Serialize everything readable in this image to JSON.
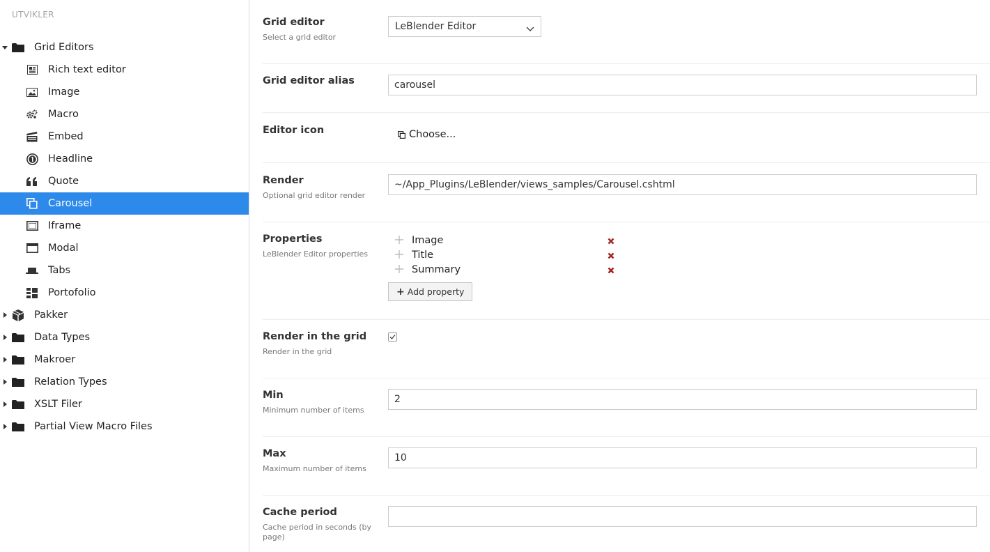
{
  "sidebar": {
    "section_title": "UTVIKLER",
    "tree": [
      {
        "label": "Grid Editors",
        "icon": "folder-icon",
        "expanded": true,
        "children": [
          {
            "label": "Rich text editor",
            "icon": "rich-text-icon"
          },
          {
            "label": "Image",
            "icon": "image-icon"
          },
          {
            "label": "Macro",
            "icon": "gears-icon"
          },
          {
            "label": "Embed",
            "icon": "film-icon"
          },
          {
            "label": "Headline",
            "icon": "headline-icon"
          },
          {
            "label": "Quote",
            "icon": "quote-icon"
          },
          {
            "label": "Carousel",
            "icon": "carousel-icon",
            "selected": true
          },
          {
            "label": "Iframe",
            "icon": "iframe-icon"
          },
          {
            "label": "Modal",
            "icon": "modal-icon"
          },
          {
            "label": "Tabs",
            "icon": "tabs-icon"
          },
          {
            "label": "Portofolio",
            "icon": "portfolio-icon"
          }
        ]
      },
      {
        "label": "Pakker",
        "icon": "package-icon"
      },
      {
        "label": "Data Types",
        "icon": "folder-icon"
      },
      {
        "label": "Makroer",
        "icon": "folder-icon"
      },
      {
        "label": "Relation Types",
        "icon": "folder-icon"
      },
      {
        "label": "XSLT Filer",
        "icon": "folder-icon"
      },
      {
        "label": "Partial View Macro Files",
        "icon": "folder-icon"
      }
    ]
  },
  "form": {
    "grid_editor": {
      "label": "Grid editor",
      "description": "Select a grid editor",
      "selected": "LeBlender Editor"
    },
    "alias": {
      "label": "Grid editor alias",
      "value": "carousel"
    },
    "icon": {
      "label": "Editor icon",
      "choose_label": "Choose..."
    },
    "render": {
      "label": "Render",
      "description": "Optional grid editor render",
      "value": "~/App_Plugins/LeBlender/views_samples/Carousel.cshtml"
    },
    "properties": {
      "label": "Properties",
      "description": "LeBlender Editor properties",
      "items": [
        "Image",
        "Title",
        "Summary"
      ],
      "add_label": "Add property"
    },
    "render_in_grid": {
      "label": "Render in the grid",
      "description": "Render in the grid",
      "checked": true
    },
    "min": {
      "label": "Min",
      "description": "Minimum number of items",
      "value": "2"
    },
    "max": {
      "label": "Max",
      "description": "Maximum number of items",
      "value": "10"
    },
    "cache": {
      "label": "Cache period",
      "description": "Cache period in seconds (by page)",
      "value": ""
    }
  },
  "colors": {
    "selected_bg": "#2e8aea",
    "remove_icon": "#a12222"
  }
}
